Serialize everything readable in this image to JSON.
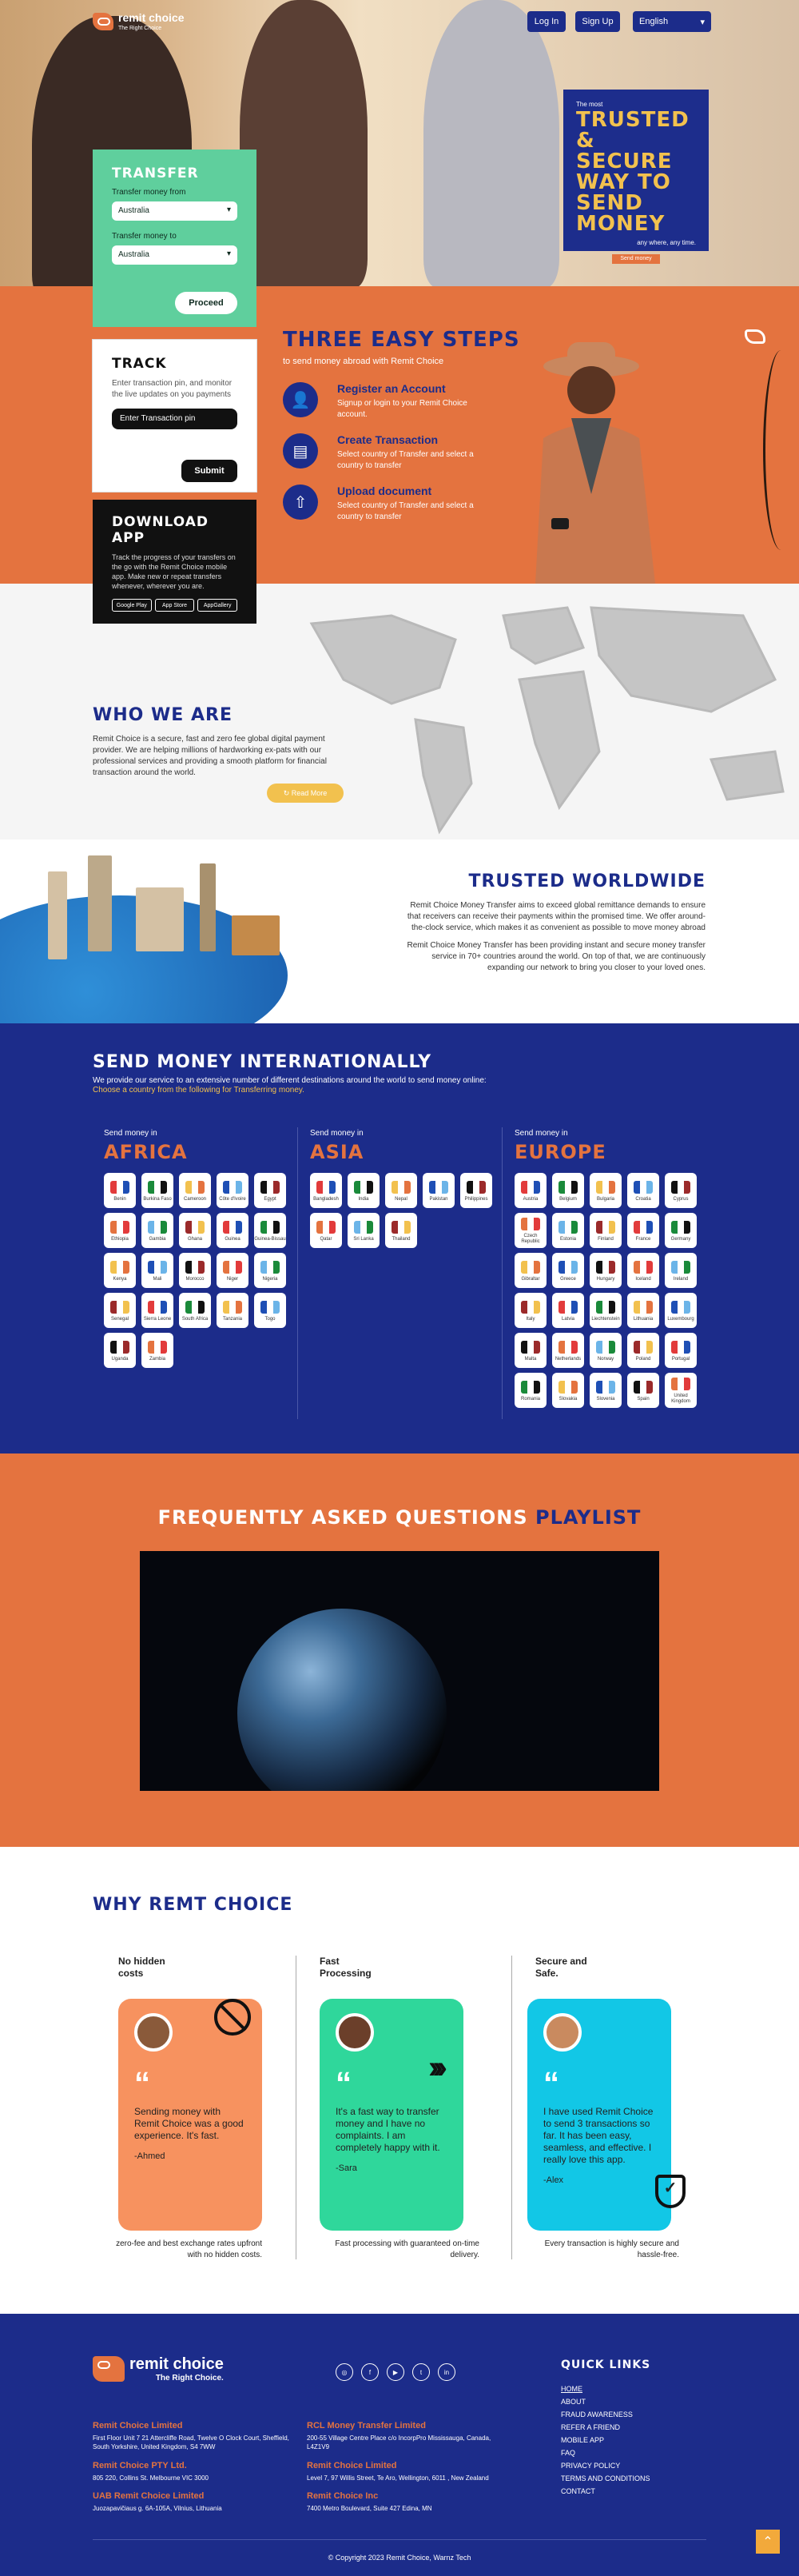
{
  "header": {
    "brand": "remit choice",
    "tagline": "The Right Choice",
    "login": "Log In",
    "signup": "Sign Up",
    "language": "English"
  },
  "poster": {
    "line1": "The most",
    "line2": "TRUSTED & SECURE WAY TO SEND MONEY",
    "line3": "any where, any time.",
    "button": "Send money"
  },
  "transfer": {
    "title": "TRANSFER",
    "from_label": "Transfer money from",
    "from_value": "Australia",
    "to_label": "Transfer money to",
    "to_value": "Australia",
    "button": "Proceed"
  },
  "track": {
    "title": "TRACK",
    "desc": "Enter transaction pin, and monitor the live updates on you payments",
    "placeholder": "Enter Transaction pin",
    "button": "Submit"
  },
  "app": {
    "title": "DOWNLOAD APP",
    "desc": "Track the progress of your transfers on the go with the Remit Choice mobile app. Make new or repeat transfers whenever, wherever you are.",
    "stores": [
      "Google Play",
      "App Store",
      "AppGallery"
    ]
  },
  "steps": {
    "title": "THREE EASY STEPS",
    "subtitle": "to send money abroad with Remit Choice",
    "items": [
      {
        "title": "Register an Account",
        "desc": "Signup or login to your Remit Choice account.",
        "icon": "user-icon"
      },
      {
        "title": "Create Transaction",
        "desc": "Select country of Transfer and select a country to transfer",
        "icon": "transaction-icon"
      },
      {
        "title": "Upload document",
        "desc": "Select country of Transfer and select a country to transfer",
        "icon": "upload-icon"
      }
    ]
  },
  "who": {
    "title": "WHO WE ARE",
    "text": "Remit Choice is a secure, fast and zero fee global digital payment provider. We are helping millions of hardworking ex-pats with our professional services and providing a smooth platform for financial transaction around the world.",
    "button": "Read More"
  },
  "trusted": {
    "title": "TRUSTED WORLDWIDE",
    "p1": "Remit Choice Money Transfer aims to exceed global remittance demands to ensure that receivers can receive their payments within the promised time. We offer around-the-clock service, which makes it as convenient as possible to move money abroad",
    "p2": "Remit Choice Money Transfer has been providing instant and secure money transfer service in 70+ countries around the world. On top of that, we are continuously expanding our network to bring you closer to your loved ones."
  },
  "send": {
    "title": "SEND MONEY INTERNATIONALLY",
    "sub1": "We provide our service to an extensive number of different destinations around the world to send money online:",
    "sub2": "Choose a country from the following for Transferring money.",
    "regions": [
      {
        "label": "Send money in",
        "name": "AFRICA",
        "countries": [
          "Benin",
          "Burkina Faso",
          "Cameroon",
          "Côte d'Ivoire",
          "Egypt",
          "Ethiopia",
          "Gambia",
          "Ghana",
          "Guinea",
          "Guinea-Bissau",
          "Kenya",
          "Mali",
          "Morocco",
          "Niger",
          "Nigeria",
          "Senegal",
          "Sierra Leone",
          "South Africa",
          "Tanzania",
          "Togo",
          "Uganda",
          "Zambia"
        ]
      },
      {
        "label": "Send money in",
        "name": "ASIA",
        "countries": [
          "Bangladesh",
          "India",
          "Nepal",
          "Pakistan",
          "Philippines",
          "Qatar",
          "Sri Lanka",
          "Thailand"
        ]
      },
      {
        "label": "Send money in",
        "name": "EUROPE",
        "countries": [
          "Austria",
          "Belgium",
          "Bulgaria",
          "Croatia",
          "Cyprus",
          "Czech Republic",
          "Estonia",
          "Finland",
          "France",
          "Germany",
          "Gibraltar",
          "Greece",
          "Hungary",
          "Iceland",
          "Ireland",
          "Italy",
          "Latvia",
          "Liechtenstein",
          "Lithuania",
          "Luxembourg",
          "Malta",
          "Netherlands",
          "Norway",
          "Poland",
          "Portugal",
          "Romania",
          "Slovakia",
          "Slovenia",
          "Spain",
          "United Kingdom"
        ]
      }
    ]
  },
  "faq": {
    "title_a": "FREQUENTLY ASKED QUESTIONS",
    "title_b": "PLAYLIST"
  },
  "why": {
    "title": "WHY REMT CHOICE",
    "cols": [
      {
        "head": "No hidden costs",
        "quote": "Sending money with Remit Choice was a good experience. It's fast.",
        "author": "-Ahmed",
        "caption": "zero-fee and best exchange rates upfront with no hidden costs.",
        "color": "#f7925f"
      },
      {
        "head": "Fast Processing",
        "quote": "It's a fast way to transfer money and I have no complaints. I am completely happy with it.",
        "author": "-Sara",
        "caption": "Fast processing with guaranteed on-time delivery.",
        "color": "#2fd79b"
      },
      {
        "head": "Secure and Safe.",
        "quote": "I have used Remit Choice to send 3 transactions so far. It has been easy, seamless, and effective. I really love this app.",
        "author": "-Alex",
        "caption": "Every transaction is highly secure and hassle-free.",
        "color": "#12c7e6"
      }
    ]
  },
  "footer": {
    "brand": "remit choice",
    "tagline": "The Right Choice.",
    "social": [
      "ig",
      "f",
      "yt",
      "tw",
      "in"
    ],
    "quick_title": "QUICK LINKS",
    "links": [
      "HOME",
      "ABOUT",
      "FRAUD AWARENESS",
      "REFER A FRIEND",
      "MOBILE APP",
      "FAQ",
      "PRIVACY POLICY",
      "TERMS AND CONDITIONS",
      "CONTACT"
    ],
    "offices": [
      {
        "name": "Remit Choice Limited",
        "addr": "First Floor Unit 7 21 Attercliffe Road, Twelve O Clock Court, Sheffield, South Yorkshire, United Kingdom, S4 7WW"
      },
      {
        "name": "Remit Choice PTY Ltd.",
        "addr": "805 220, Collins St. Melbourne VIC 3000"
      },
      {
        "name": "UAB Remit Choice Limited",
        "addr": "Juozapavičiaus g. 6A-105A, Vilnius, Lithuania"
      },
      {
        "name": "RCL Money Transfer Limited",
        "addr": "200-55 Village Centre Place c/o IncorpPro Mississauga, Canada, L4Z1V9"
      },
      {
        "name": "Remit Choice Limited",
        "addr": "Level 7, 97 Willis Street, Te Aro, Wellington, 6011 , New Zealand"
      },
      {
        "name": "Remit Choice Inc",
        "addr": "7400 Metro Boulevard, Suite 427 Edina, MN"
      }
    ],
    "copyright": "© Copyright 2023 Remit Choice, Warnz Tech"
  },
  "colors": {
    "navy": "#1c2c8a",
    "orange": "#e4733f",
    "yellow": "#f2c14e",
    "green": "#5fcf9d"
  }
}
